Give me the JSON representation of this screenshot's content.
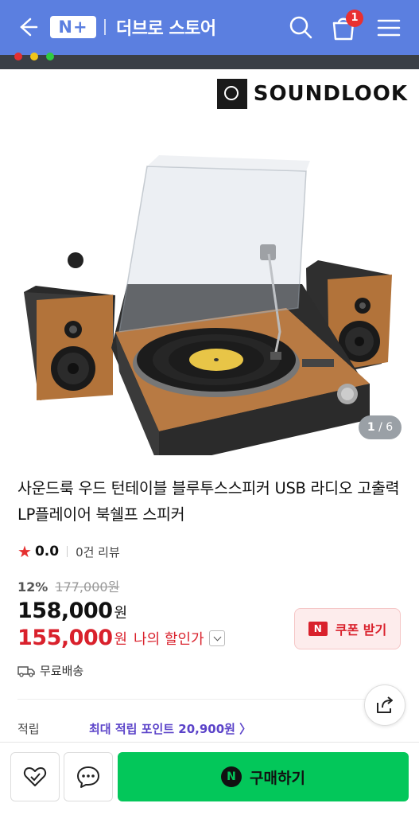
{
  "header": {
    "logo": "N+",
    "store_name": "더브로 스토어",
    "cart_count": "1",
    "colors": {
      "bg": "#5b7fe0",
      "badge": "#e93030"
    }
  },
  "image": {
    "brand": "SOUNDLOOK",
    "counter_current": "1",
    "counter_total": "/ 6"
  },
  "product": {
    "title": "사운드룩 우드 턴테이블 블루투스스피커 USB 라디오 고출력 LP플레이어 북쉘프 스피커",
    "rating": "0.0",
    "reviews": "0건 리뷰",
    "discount_pct": "12%",
    "original_price": "177,000원",
    "price": "158,000",
    "price_unit": "원",
    "my_price": "155,000",
    "my_price_unit": "원",
    "my_price_label": "나의 할인가",
    "coupon_label": "쿠폰 받기",
    "coupon_icon": "N",
    "shipping": "무료배송",
    "points_label": "적립",
    "points": "최대 적립 포인트 20,900원 〉"
  },
  "bottom": {
    "buy_label": "구매하기",
    "buy_icon": "N",
    "buy_color": "#03c75a"
  }
}
